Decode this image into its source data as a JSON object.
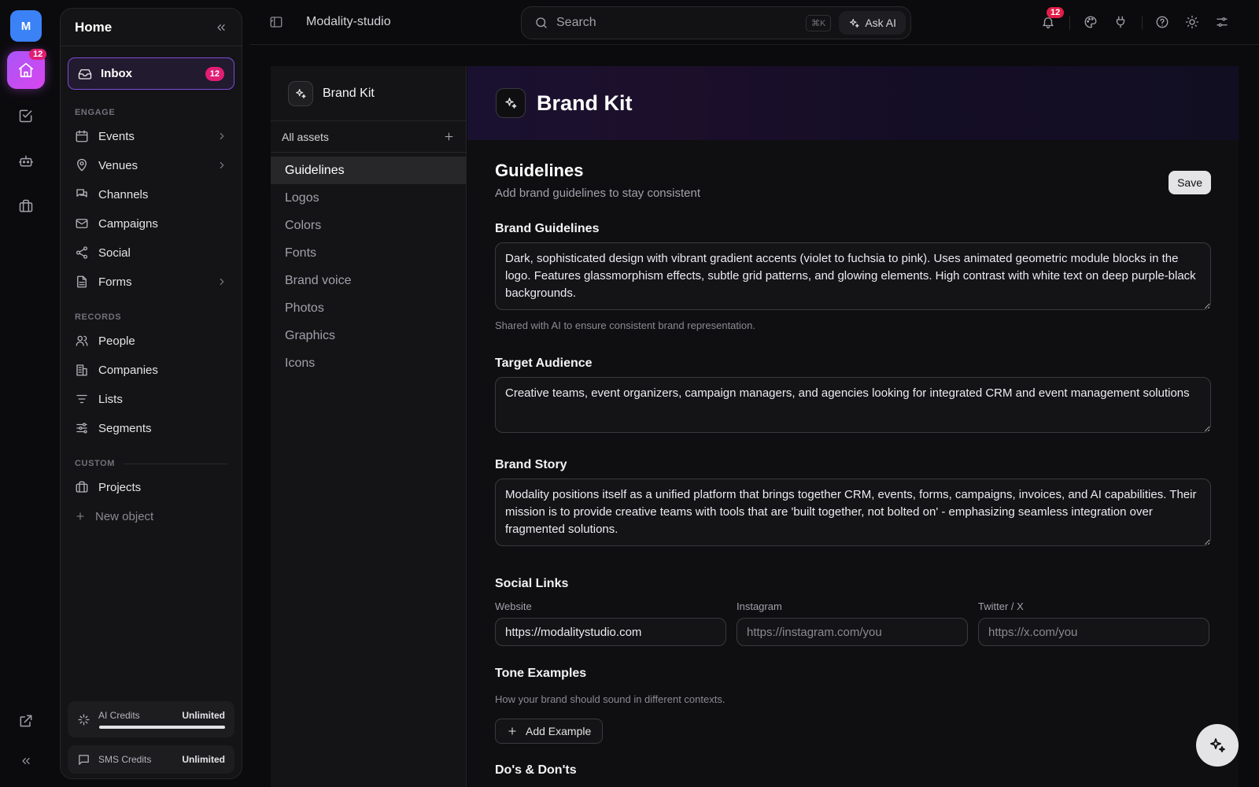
{
  "rail": {
    "avatar_letter": "M",
    "home_badge": "12"
  },
  "sidebar": {
    "title": "Home",
    "inbox": {
      "label": "Inbox",
      "count": "12"
    },
    "sections": {
      "engage": "ENGAGE",
      "records": "RECORDS",
      "custom": "CUSTOM"
    },
    "engage_items": [
      "Events",
      "Venues",
      "Channels",
      "Campaigns",
      "Social",
      "Forms"
    ],
    "records_items": [
      "People",
      "Companies",
      "Lists",
      "Segments"
    ],
    "custom_items": [
      "Projects"
    ],
    "new_object": "New object",
    "credits": [
      {
        "label": "AI Credits",
        "value": "Unlimited",
        "progress": 1.0
      },
      {
        "label": "SMS Credits",
        "value": "Unlimited"
      }
    ]
  },
  "topbar": {
    "workspace": "Modality-studio",
    "search_placeholder": "Search",
    "shortcut": "⌘K",
    "ask_ai": "Ask AI",
    "notification_count": "12"
  },
  "assets_panel": {
    "title": "Brand Kit",
    "all_assets": "All assets",
    "items": [
      "Guidelines",
      "Logos",
      "Colors",
      "Fonts",
      "Brand voice",
      "Photos",
      "Graphics",
      "Icons"
    ],
    "active": "Guidelines"
  },
  "main": {
    "title": "Brand Kit",
    "section_title": "Guidelines",
    "section_subtitle": "Add brand guidelines to stay consistent",
    "save_label": "Save",
    "brand_guidelines": {
      "label": "Brand Guidelines",
      "value": "Dark, sophisticated design with vibrant gradient accents (violet to fuchsia to pink). Uses animated geometric module blocks in the logo. Features glassmorphism effects, subtle grid patterns, and glowing elements. High contrast with white text on deep purple-black backgrounds.",
      "help": "Shared with AI to ensure consistent brand representation."
    },
    "target_audience": {
      "label": "Target Audience",
      "value": "Creative teams, event organizers, campaign managers, and agencies looking for integrated CRM and event management solutions"
    },
    "brand_story": {
      "label": "Brand Story",
      "value": "Modality positions itself as a unified platform that brings together CRM, events, forms, campaigns, invoices, and AI capabilities. Their mission is to provide creative teams with tools that are 'built together, not bolted on' - emphasizing seamless integration over fragmented solutions."
    },
    "social_links": {
      "label": "Social Links",
      "website": {
        "label": "Website",
        "value": "https://modalitystudio.com",
        "placeholder": ""
      },
      "instagram": {
        "label": "Instagram",
        "value": "",
        "placeholder": "https://instagram.com/you"
      },
      "twitter": {
        "label": "Twitter / X",
        "value": "",
        "placeholder": "https://x.com/you"
      }
    },
    "tone_examples": {
      "label": "Tone Examples",
      "help": "How your brand should sound in different contexts.",
      "add_label": "Add Example"
    },
    "dos_donts": {
      "label": "Do's & Don'ts"
    }
  },
  "colors": {
    "accent": "#a855f7",
    "badge": "#e11d74",
    "focus_border": "#7c4ddb"
  }
}
